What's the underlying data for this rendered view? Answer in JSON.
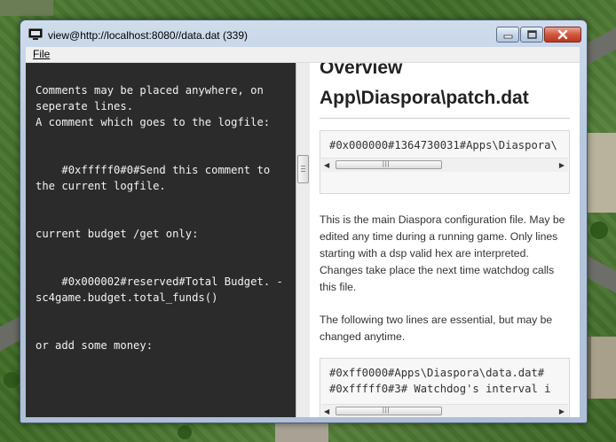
{
  "window": {
    "title": "view@http://localhost:8080//data.dat (339)"
  },
  "menu": {
    "file_label": "File"
  },
  "left_pane": {
    "code": "Comments may be placed anywhere, on seperate lines.\nA comment which goes to the logfile:\n\n\n    #0xfffff0#0#Send this comment to the current logfile.\n\n\ncurrent budget /get only:\n\n\n    #0x000002#reserved#Total Budget. - sc4game.budget.total_funds()\n\n\nor add some money:"
  },
  "right_pane": {
    "heading_top": "Overview",
    "heading": "App\\Diaspora\\patch.dat",
    "code_box_1": [
      "#0x000000#1364730031#Apps\\Diaspora\\"
    ],
    "paragraph_1": "This is the main Diaspora configuration file. May be edited any time during a running game. Only lines starting with a dsp valid hex are interpreted. Changes take place the next time watchdog calls this file.",
    "paragraph_2": "The following two lines are essential, but may be changed anytime.",
    "code_box_2": [
      "#0xff0000#Apps\\Diaspora\\data.dat#",
      "#0xfffff0#3# Watchdog's interval i"
    ]
  },
  "icons": {
    "app": "computer-monitor-icon",
    "minimize": "minimize-icon",
    "maximize": "maximize-icon",
    "close": "close-icon"
  }
}
